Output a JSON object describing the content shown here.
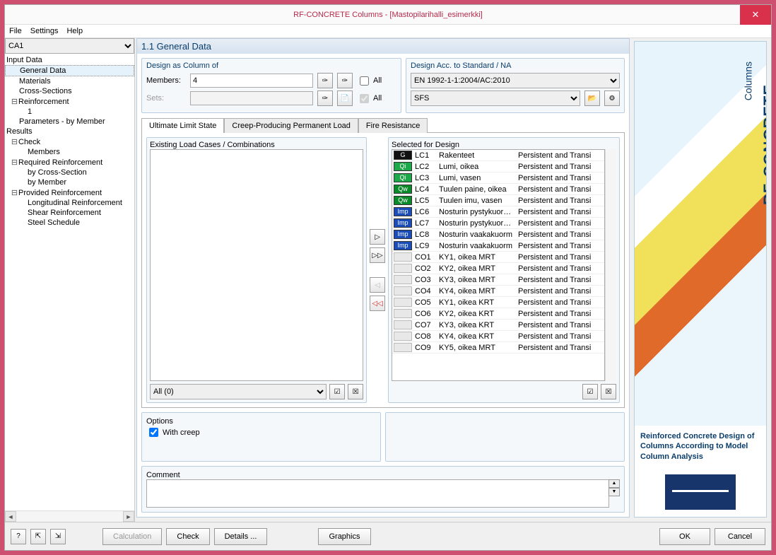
{
  "title": "RF-CONCRETE Columns - [Mastopilarihalli_esimerkki]",
  "menu": {
    "file": "File",
    "settings": "Settings",
    "help": "Help"
  },
  "case_selector": "CA1",
  "tree": {
    "input": "Input Data",
    "general": "General Data",
    "materials": "Materials",
    "cross": "Cross-Sections",
    "reinf": "Reinforcement",
    "reinf1": "1",
    "params": "Parameters - by Member",
    "results": "Results",
    "check": "Check",
    "check_members": "Members",
    "req": "Required Reinforcement",
    "req_cs": "by Cross-Section",
    "req_m": "by Member",
    "prov": "Provided Reinforcement",
    "prov_long": "Longitudinal Reinforcement",
    "prov_shear": "Shear Reinforcement",
    "prov_steel": "Steel Schedule"
  },
  "panel_title": "1.1 General Data",
  "design": {
    "title": "Design as Column of",
    "members_label": "Members:",
    "members_value": "4",
    "sets_label": "Sets:",
    "sets_value": "",
    "all": "All"
  },
  "standard": {
    "title": "Design Acc. to Standard / NA",
    "code": " EN 1992-1-1:2004/AC:2010",
    "na": " SFS"
  },
  "tabs": {
    "uls": "Ultimate Limit State",
    "creep": "Creep-Producing Permanent Load",
    "fire": "Fire Resistance"
  },
  "existing": {
    "title": "Existing Load Cases / Combinations",
    "filter": "All (0)"
  },
  "selected": {
    "title": "Selected for Design",
    "rows": [
      {
        "tag": "G",
        "id": "LC1",
        "name": "Rakenteet",
        "sit": "Persistent and Transi"
      },
      {
        "tag": "Qi",
        "id": "LC2",
        "name": "Lumi, oikea",
        "sit": "Persistent and Transi"
      },
      {
        "tag": "Qi",
        "id": "LC3",
        "name": "Lumi, vasen",
        "sit": "Persistent and Transi"
      },
      {
        "tag": "Qw",
        "id": "LC4",
        "name": "Tuulen paine, oikea",
        "sit": "Persistent and Transi"
      },
      {
        "tag": "Qw",
        "id": "LC5",
        "name": "Tuulen imu, vasen",
        "sit": "Persistent and Transi"
      },
      {
        "tag": "Imp",
        "id": "LC6",
        "name": "Nosturin pystykuorma,",
        "sit": "Persistent and Transi"
      },
      {
        "tag": "Imp",
        "id": "LC7",
        "name": "Nosturin pystykuorma,",
        "sit": "Persistent and Transi"
      },
      {
        "tag": "Imp",
        "id": "LC8",
        "name": "Nosturin vaakakuorm",
        "sit": "Persistent and Transi"
      },
      {
        "tag": "Imp",
        "id": "LC9",
        "name": "Nosturin vaakakuorm",
        "sit": "Persistent and Transi"
      },
      {
        "tag": "blank",
        "id": "CO1",
        "name": "KY1, oikea MRT",
        "sit": "Persistent and Transi"
      },
      {
        "tag": "blank",
        "id": "CO2",
        "name": "KY2, oikea MRT",
        "sit": "Persistent and Transi"
      },
      {
        "tag": "blank",
        "id": "CO3",
        "name": "KY3, oikea MRT",
        "sit": "Persistent and Transi"
      },
      {
        "tag": "blank",
        "id": "CO4",
        "name": "KY4, oikea MRT",
        "sit": "Persistent and Transi"
      },
      {
        "tag": "blank",
        "id": "CO5",
        "name": "KY1, oikea KRT",
        "sit": "Persistent and Transi"
      },
      {
        "tag": "blank",
        "id": "CO6",
        "name": "KY2, oikea KRT",
        "sit": "Persistent and Transi"
      },
      {
        "tag": "blank",
        "id": "CO7",
        "name": "KY3, oikea KRT",
        "sit": "Persistent and Transi"
      },
      {
        "tag": "blank",
        "id": "CO8",
        "name": "KY4, oikea KRT",
        "sit": "Persistent and Transi"
      },
      {
        "tag": "blank",
        "id": "CO9",
        "name": "KY5, oikea MRT",
        "sit": "Persistent and Transi"
      }
    ]
  },
  "options": {
    "title": "Options",
    "with_creep": "With creep"
  },
  "comment": {
    "title": "Comment",
    "value": ""
  },
  "sidebar": {
    "brand": "RF-CONCRETE",
    "sub": "Columns",
    "desc": "Reinforced Concrete Design of Columns According to Model Column Analysis"
  },
  "footer": {
    "calc": "Calculation",
    "check": "Check",
    "details": "Details ...",
    "graphics": "Graphics",
    "ok": "OK",
    "cancel": "Cancel"
  }
}
